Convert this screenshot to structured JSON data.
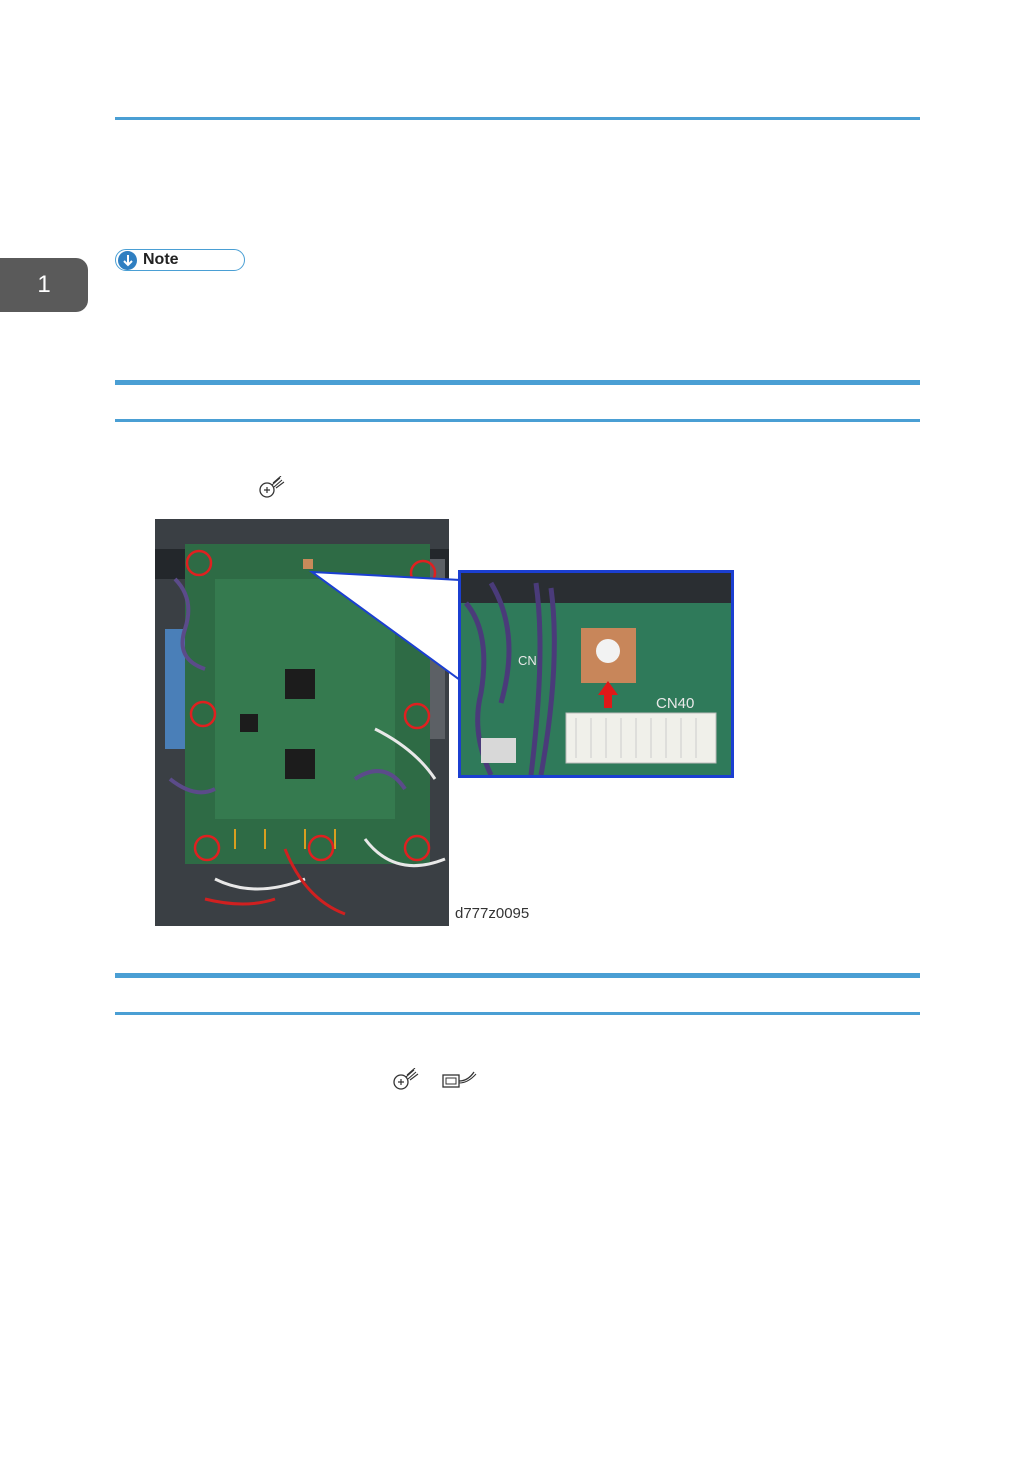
{
  "chapter": {
    "number": "1"
  },
  "note": {
    "label": "Note"
  },
  "figure": {
    "caption": "d777z0095",
    "zoom_label": "CN40"
  },
  "icons": {
    "screw": "screw-icon",
    "connector": "connector-icon",
    "note": "note-arrow-icon"
  },
  "colors": {
    "accent": "#4a9fd4",
    "highlight_box": "#1b3fd1",
    "circle_marker": "#e02020"
  }
}
